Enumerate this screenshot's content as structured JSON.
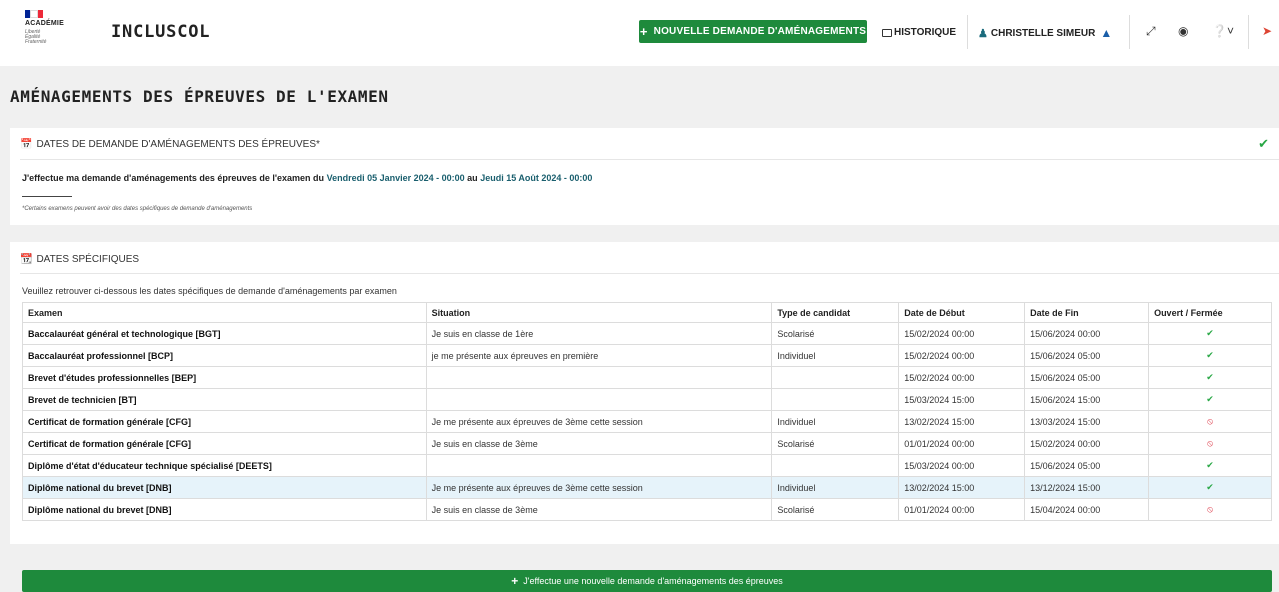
{
  "header": {
    "academie": "ACADÉMIE",
    "motto": [
      "Liberté",
      "Égalité",
      "Fraternité"
    ],
    "app_title": "INCLUSCOL",
    "new_request_label": "NOUVELLE DEMANDE D'AMÉNAGEMENTS",
    "history_label": "HISTORIQUE",
    "user_name": "CHRISTELLE SIMEUR",
    "icons": [
      "user-icon",
      "graduation-cap-icon",
      "expand-icon",
      "eye-icon",
      "help-icon",
      "logout-icon"
    ]
  },
  "page_title": "AMÉNAGEMENTS DES ÉPREUVES DE L'EXAMEN",
  "dates_card": {
    "title": "DATES DE DEMANDE D'AMÉNAGEMENTS DES ÉPREUVES*",
    "sentence_prefix": "J'effectue ma demande d'aménagements des épreuves de l'examen du",
    "start": "Vendredi 05 Janvier 2024 - 00:00",
    "connector": "au",
    "end": "Jeudi 15 Août 2024 - 00:00",
    "footnote": "*Certains examens peuvent avoir des dates spécifiques de demande d'aménagements"
  },
  "specific_card": {
    "title": "DATES SPÉCIFIQUES",
    "intro": "Veuillez retrouver ci-dessous les dates spécifiques de demande d'aménagements par examen",
    "columns": [
      "Examen",
      "Situation",
      "Type de candidat",
      "Date de Début",
      "Date de Fin",
      "Ouvert / Fermée"
    ],
    "rows": [
      {
        "examen": "Baccalauréat général et technologique [BGT]",
        "situation": "Je suis en classe de 1ère",
        "type": "Scolarisé",
        "debut": "15/02/2024 00:00",
        "fin": "15/06/2024 00:00",
        "open": true
      },
      {
        "examen": "Baccalauréat professionnel [BCP]",
        "situation": "je me présente aux épreuves en première",
        "type": "Individuel",
        "debut": "15/02/2024 00:00",
        "fin": "15/06/2024 05:00",
        "open": true
      },
      {
        "examen": "Brevet d'études professionnelles [BEP]",
        "situation": "",
        "type": "",
        "debut": "15/02/2024 00:00",
        "fin": "15/06/2024 05:00",
        "open": true
      },
      {
        "examen": "Brevet de technicien [BT]",
        "situation": "",
        "type": "",
        "debut": "15/03/2024 15:00",
        "fin": "15/06/2024 15:00",
        "open": true
      },
      {
        "examen": "Certificat de formation générale [CFG]",
        "situation": "Je me présente aux épreuves de 3ème cette session",
        "type": "Individuel",
        "debut": "13/02/2024 15:00",
        "fin": "13/03/2024 15:00",
        "open": false
      },
      {
        "examen": "Certificat de formation générale [CFG]",
        "situation": "Je suis en classe de 3ème",
        "type": "Scolarisé",
        "debut": "01/01/2024 00:00",
        "fin": "15/02/2024 00:00",
        "open": false
      },
      {
        "examen": "Diplôme d'état d'éducateur technique spécialisé [DEETS]",
        "situation": "",
        "type": "",
        "debut": "15/03/2024 00:00",
        "fin": "15/06/2024 05:00",
        "open": true
      },
      {
        "examen": "Diplôme national du brevet [DNB]",
        "situation": "Je me présente aux épreuves de 3ème cette session",
        "type": "Individuel",
        "debut": "13/02/2024 15:00",
        "fin": "13/12/2024 15:00",
        "open": true,
        "highlight": true
      },
      {
        "examen": "Diplôme national du brevet [DNB]",
        "situation": "Je suis en classe de 3ème",
        "type": "Scolarisé",
        "debut": "01/01/2024 00:00",
        "fin": "15/04/2024 00:00",
        "open": false
      }
    ]
  },
  "bottom_button_label": "J'effectue une nouvelle demande d'aménagements des épreuves",
  "colors": {
    "green": "#1e8a3c",
    "teal": "#1a5f6e",
    "ok": "#28a745",
    "closed": "#dc3545"
  }
}
